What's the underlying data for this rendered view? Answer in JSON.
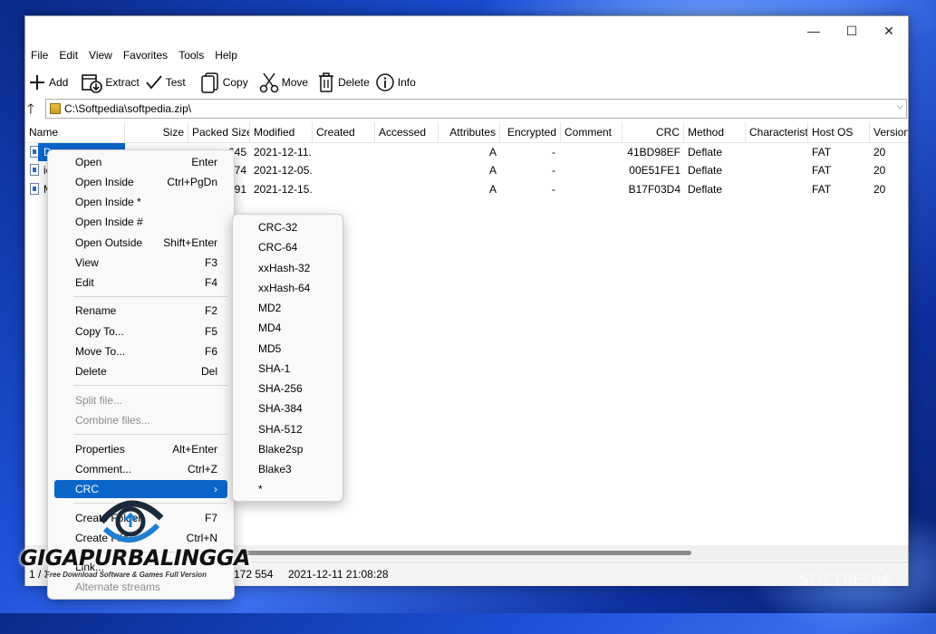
{
  "window": {
    "minimize": "—",
    "maximize": "☐",
    "close": "✕"
  },
  "menu": [
    "File",
    "Edit",
    "View",
    "Favorites",
    "Tools",
    "Help"
  ],
  "toolbar": [
    {
      "label": "Add",
      "icon": "plus-icon"
    },
    {
      "label": "Extract",
      "icon": "extract-icon"
    },
    {
      "label": "Test",
      "icon": "check-icon"
    },
    {
      "label": "Copy",
      "icon": "copy-icon"
    },
    {
      "label": "Move",
      "icon": "scissors-icon"
    },
    {
      "label": "Delete",
      "icon": "trash-icon"
    },
    {
      "label": "Info",
      "icon": "info-icon"
    }
  ],
  "address": {
    "up": "🡑",
    "path": "C:\\Softpedia\\softpedia.zip\\",
    "dropdown": "⌵"
  },
  "columns": [
    "Name",
    "Size",
    "Packed Size",
    "Modified",
    "Created",
    "Accessed",
    "Attributes",
    "Encrypted",
    "Comment",
    "CRC",
    "Method",
    "Characterist...",
    "Host OS",
    "Version"
  ],
  "rows": [
    {
      "name": "D",
      "size": "",
      "packed": "645",
      "modified": "2021-12-11...",
      "created": "",
      "accessed": "",
      "attributes": "A",
      "encrypted": "-",
      "comment": "",
      "crc": "41BD98EF",
      "method": "Deflate",
      "char": "",
      "hostos": "FAT",
      "version": "20"
    },
    {
      "name": "ic",
      "size": "",
      "packed": "174",
      "modified": "2021-12-05...",
      "created": "",
      "accessed": "",
      "attributes": "A",
      "encrypted": "-",
      "comment": "",
      "crc": "00E51FE1",
      "method": "Deflate",
      "char": "",
      "hostos": "FAT",
      "version": "20"
    },
    {
      "name": "M",
      "size": "",
      "packed": "291",
      "modified": "2021-12-15...",
      "created": "",
      "accessed": "",
      "attributes": "A",
      "encrypted": "-",
      "comment": "",
      "crc": "B17F03D4",
      "method": "Deflate",
      "char": "",
      "hostos": "FAT",
      "version": "20"
    }
  ],
  "status": {
    "selection": "1 / 3",
    "size": "172 554",
    "date": "2021-12-11 21:08:28"
  },
  "context_menu": [
    {
      "label": "Open",
      "key": "Enter"
    },
    {
      "label": "Open Inside",
      "key": "Ctrl+PgDn"
    },
    {
      "label": "Open Inside *",
      "key": ""
    },
    {
      "label": "Open Inside #",
      "key": ""
    },
    {
      "label": "Open Outside",
      "key": "Shift+Enter"
    },
    {
      "label": "View",
      "key": "F3"
    },
    {
      "label": "Edit",
      "key": "F4"
    },
    {
      "label": "Rename",
      "key": "F2"
    },
    {
      "label": "Copy To...",
      "key": "F5"
    },
    {
      "label": "Move To...",
      "key": "F6"
    },
    {
      "label": "Delete",
      "key": "Del"
    },
    {
      "label": "Split file...",
      "key": ""
    },
    {
      "label": "Combine files...",
      "key": ""
    },
    {
      "label": "Properties",
      "key": "Alt+Enter"
    },
    {
      "label": "Comment...",
      "key": "Ctrl+Z"
    },
    {
      "label": "CRC",
      "key": "›"
    },
    {
      "label": "Create Folder",
      "key": "F7"
    },
    {
      "label": "Create File",
      "key": "Ctrl+N"
    },
    {
      "label": "Link...",
      "key": ""
    },
    {
      "label": "Alternate streams",
      "key": ""
    }
  ],
  "crc_submenu": [
    "CRC-32",
    "CRC-64",
    "xxHash-32",
    "xxHash-64",
    "MD2",
    "MD4",
    "MD5",
    "SHA-1",
    "SHA-256",
    "SHA-384",
    "SHA-512",
    "Blake2sp",
    "Blake3",
    "*"
  ],
  "overlay": {
    "brand": "GIGAPURBALINGGA",
    "tagline": "Free Download Software & Games Full Version",
    "watermark": "SOFTPEDIA"
  },
  "colors": {
    "selection": "#0a66c9",
    "desktop": "#1c50d8"
  }
}
